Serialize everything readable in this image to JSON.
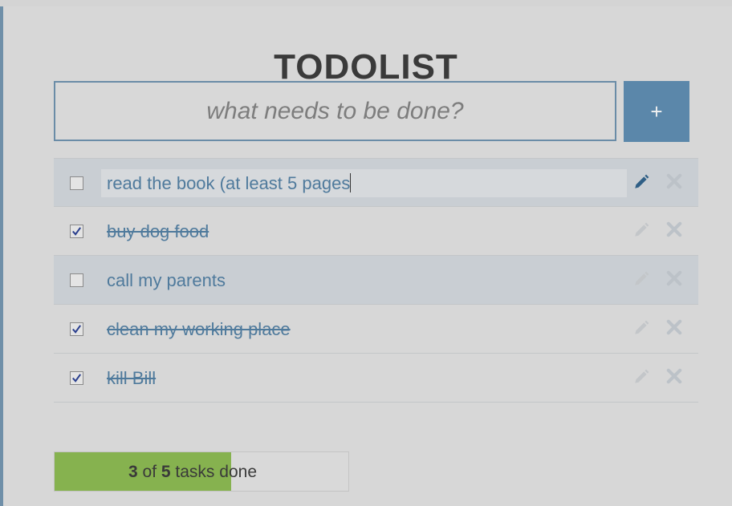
{
  "app": {
    "title": "TODOLIST"
  },
  "new_task": {
    "placeholder": "what needs to be done?",
    "add_label": "+"
  },
  "tasks": [
    {
      "text": "read the book (at least 5 pages",
      "done": false,
      "editing": true
    },
    {
      "text": "buy dog food",
      "done": true,
      "editing": false
    },
    {
      "text": "call my parents",
      "done": false,
      "editing": false
    },
    {
      "text": "clean my working place",
      "done": true,
      "editing": false
    },
    {
      "text": "kill Bill",
      "done": true,
      "editing": false
    }
  ],
  "progress": {
    "done_count": "3",
    "of_text": "of",
    "total_count": "5",
    "tasks_text": "tasks",
    "done_text": "done",
    "fraction": 0.6
  },
  "colors": {
    "accent": "#5b87aa",
    "task_text": "#4f7a9c",
    "progress_fill": "#86b24f",
    "active_edit_icon": "#2f5f86",
    "inactive_icon": "#bfc3c7",
    "delete_icon": "#bcc2c8"
  },
  "icons": {
    "edit": "pencil-icon",
    "delete": "close-icon",
    "check": "checkmark-icon"
  }
}
